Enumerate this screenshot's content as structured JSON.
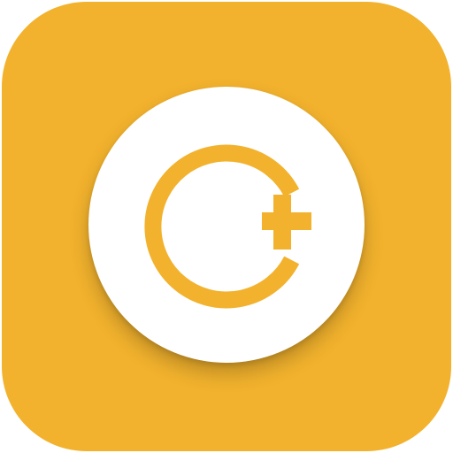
{
  "app_icon": {
    "icon_name": "ring-with-plus-icon",
    "colors": {
      "tile_background": "#F2B22D",
      "disc": "#FFFFFF",
      "glyph": "#F2B22D"
    }
  }
}
